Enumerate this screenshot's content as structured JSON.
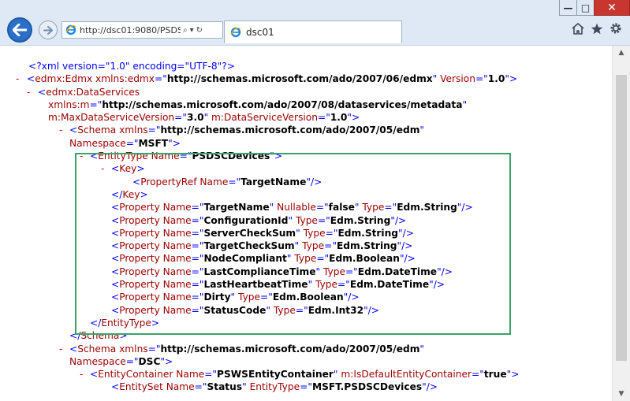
{
  "window": {
    "buttons": {
      "minimize": "—",
      "maximize": "□",
      "close": "✕"
    }
  },
  "toolbar": {
    "address": "http://dsc01:9080/PSDS",
    "search_glyph": "⌕",
    "dropdown_glyph": "▾",
    "refresh_glyph": "↻",
    "tab_title": "dsc01",
    "icons": [
      "home-icon",
      "favorites-star-icon",
      "settings-gear-icon"
    ]
  },
  "colors": {
    "markup": "#0000ff",
    "attribute": "#990000",
    "value": "#000000",
    "collapse_minus": "#e0001a",
    "highlight_border": "#3ba36a"
  },
  "xml": {
    "minus": "-",
    "lines": [
      {
        "m": "",
        "s": [
          [
            "b",
            "<?xml version=\"1.0\" encoding=\"UTF-8\"?>"
          ]
        ]
      },
      {
        "m": "-",
        "s": [
          [
            "b",
            "<"
          ],
          [
            "r",
            "edmx:Edmx "
          ],
          [
            "r",
            "xmlns:edmx"
          ],
          [
            "b",
            "=\""
          ],
          [
            "k",
            "http://schemas.microsoft.com/ado/2007/06/edmx"
          ],
          [
            "b",
            "\" "
          ],
          [
            "r",
            "Version"
          ],
          [
            "b",
            "=\""
          ],
          [
            "k",
            "1.0"
          ],
          [
            "b",
            "\">"
          ]
        ]
      },
      {
        "m": "-",
        "s": [
          [
            "b",
            "<"
          ],
          [
            "r",
            "edmx:DataServices"
          ]
        ]
      },
      {
        "m": "",
        "s": [
          [
            "r",
            "xmlns:m"
          ],
          [
            "b",
            "=\""
          ],
          [
            "k",
            "http://schemas.microsoft.com/ado/2007/08/dataservices/metadata"
          ],
          [
            "b",
            "\""
          ]
        ]
      },
      {
        "m": "",
        "s": [
          [
            "r",
            "m:MaxDataServiceVersion"
          ],
          [
            "b",
            "=\""
          ],
          [
            "k",
            "3.0"
          ],
          [
            "b",
            "\" "
          ],
          [
            "r",
            "m:DataServiceVersion"
          ],
          [
            "b",
            "=\""
          ],
          [
            "k",
            "1.0"
          ],
          [
            "b",
            "\">"
          ]
        ]
      },
      {
        "m": "-",
        "s": [
          [
            "b",
            "<"
          ],
          [
            "r",
            "Schema "
          ],
          [
            "r",
            "xmlns"
          ],
          [
            "b",
            "=\""
          ],
          [
            "k",
            "http://schemas.microsoft.com/ado/2007/05/edm"
          ],
          [
            "b",
            "\""
          ]
        ]
      },
      {
        "m": "",
        "s": [
          [
            "r",
            "Namespace"
          ],
          [
            "b",
            "=\""
          ],
          [
            "k",
            "MSFT"
          ],
          [
            "b",
            "\">"
          ]
        ]
      },
      {
        "m": "-",
        "s": [
          [
            "b",
            "<"
          ],
          [
            "r",
            "EntityType "
          ],
          [
            "r",
            "Name"
          ],
          [
            "b",
            "=\""
          ],
          [
            "k",
            "PSDSCDevices"
          ],
          [
            "b",
            "\">"
          ]
        ]
      },
      {
        "m": "-",
        "s": [
          [
            "b",
            "<"
          ],
          [
            "r",
            "Key"
          ],
          [
            "b",
            ">"
          ]
        ]
      },
      {
        "m": "",
        "s": [
          [
            "b",
            "<"
          ],
          [
            "r",
            "PropertyRef "
          ],
          [
            "r",
            "Name"
          ],
          [
            "b",
            "=\""
          ],
          [
            "k",
            "TargetName"
          ],
          [
            "b",
            "\"/>"
          ]
        ]
      },
      {
        "m": "",
        "s": [
          [
            "b",
            "</"
          ],
          [
            "r",
            "Key"
          ],
          [
            "b",
            ">"
          ]
        ]
      },
      {
        "m": "",
        "s": [
          [
            "b",
            "<"
          ],
          [
            "r",
            "Property "
          ],
          [
            "r",
            "Name"
          ],
          [
            "b",
            "=\""
          ],
          [
            "k",
            "TargetName"
          ],
          [
            "b",
            "\" "
          ],
          [
            "r",
            "Nullable"
          ],
          [
            "b",
            "=\""
          ],
          [
            "k",
            "false"
          ],
          [
            "b",
            "\" "
          ],
          [
            "r",
            "Type"
          ],
          [
            "b",
            "=\""
          ],
          [
            "k",
            "Edm.String"
          ],
          [
            "b",
            "\"/>"
          ]
        ]
      },
      {
        "m": "",
        "s": [
          [
            "b",
            "<"
          ],
          [
            "r",
            "Property "
          ],
          [
            "r",
            "Name"
          ],
          [
            "b",
            "=\""
          ],
          [
            "k",
            "ConfigurationId"
          ],
          [
            "b",
            "\" "
          ],
          [
            "r",
            "Type"
          ],
          [
            "b",
            "=\""
          ],
          [
            "k",
            "Edm.String"
          ],
          [
            "b",
            "\"/>"
          ]
        ]
      },
      {
        "m": "",
        "s": [
          [
            "b",
            "<"
          ],
          [
            "r",
            "Property "
          ],
          [
            "r",
            "Name"
          ],
          [
            "b",
            "=\""
          ],
          [
            "k",
            "ServerCheckSum"
          ],
          [
            "b",
            "\" "
          ],
          [
            "r",
            "Type"
          ],
          [
            "b",
            "=\""
          ],
          [
            "k",
            "Edm.String"
          ],
          [
            "b",
            "\"/>"
          ]
        ]
      },
      {
        "m": "",
        "s": [
          [
            "b",
            "<"
          ],
          [
            "r",
            "Property "
          ],
          [
            "r",
            "Name"
          ],
          [
            "b",
            "=\""
          ],
          [
            "k",
            "TargetCheckSum"
          ],
          [
            "b",
            "\" "
          ],
          [
            "r",
            "Type"
          ],
          [
            "b",
            "=\""
          ],
          [
            "k",
            "Edm.String"
          ],
          [
            "b",
            "\"/>"
          ]
        ]
      },
      {
        "m": "",
        "s": [
          [
            "b",
            "<"
          ],
          [
            "r",
            "Property "
          ],
          [
            "r",
            "Name"
          ],
          [
            "b",
            "=\""
          ],
          [
            "k",
            "NodeCompliant"
          ],
          [
            "b",
            "\" "
          ],
          [
            "r",
            "Type"
          ],
          [
            "b",
            "=\""
          ],
          [
            "k",
            "Edm.Boolean"
          ],
          [
            "b",
            "\"/>"
          ]
        ]
      },
      {
        "m": "",
        "s": [
          [
            "b",
            "<"
          ],
          [
            "r",
            "Property "
          ],
          [
            "r",
            "Name"
          ],
          [
            "b",
            "=\""
          ],
          [
            "k",
            "LastComplianceTime"
          ],
          [
            "b",
            "\" "
          ],
          [
            "r",
            "Type"
          ],
          [
            "b",
            "=\""
          ],
          [
            "k",
            "Edm.DateTime"
          ],
          [
            "b",
            "\"/>"
          ]
        ]
      },
      {
        "m": "",
        "s": [
          [
            "b",
            "<"
          ],
          [
            "r",
            "Property "
          ],
          [
            "r",
            "Name"
          ],
          [
            "b",
            "=\""
          ],
          [
            "k",
            "LastHeartbeatTime"
          ],
          [
            "b",
            "\" "
          ],
          [
            "r",
            "Type"
          ],
          [
            "b",
            "=\""
          ],
          [
            "k",
            "Edm.DateTime"
          ],
          [
            "b",
            "\"/>"
          ]
        ]
      },
      {
        "m": "",
        "s": [
          [
            "b",
            "<"
          ],
          [
            "r",
            "Property "
          ],
          [
            "r",
            "Name"
          ],
          [
            "b",
            "=\""
          ],
          [
            "k",
            "Dirty"
          ],
          [
            "b",
            "\" "
          ],
          [
            "r",
            "Type"
          ],
          [
            "b",
            "=\""
          ],
          [
            "k",
            "Edm.Boolean"
          ],
          [
            "b",
            "\"/>"
          ]
        ]
      },
      {
        "m": "",
        "s": [
          [
            "b",
            "<"
          ],
          [
            "r",
            "Property "
          ],
          [
            "r",
            "Name"
          ],
          [
            "b",
            "=\""
          ],
          [
            "k",
            "StatusCode"
          ],
          [
            "b",
            "\" "
          ],
          [
            "r",
            "Type"
          ],
          [
            "b",
            "=\""
          ],
          [
            "k",
            "Edm.Int32"
          ],
          [
            "b",
            "\"/>"
          ]
        ]
      },
      {
        "m": "",
        "s": [
          [
            "b",
            "</"
          ],
          [
            "r",
            "EntityType"
          ],
          [
            "b",
            ">"
          ]
        ]
      },
      {
        "m": "",
        "s": [
          [
            "b",
            "</"
          ],
          [
            "r",
            "Schema"
          ],
          [
            "b",
            ">"
          ]
        ]
      },
      {
        "m": "-",
        "s": [
          [
            "b",
            "<"
          ],
          [
            "r",
            "Schema "
          ],
          [
            "r",
            "xmlns"
          ],
          [
            "b",
            "=\""
          ],
          [
            "k",
            "http://schemas.microsoft.com/ado/2007/05/edm"
          ],
          [
            "b",
            "\""
          ]
        ]
      },
      {
        "m": "",
        "s": [
          [
            "r",
            "Namespace"
          ],
          [
            "b",
            "=\""
          ],
          [
            "k",
            "DSC"
          ],
          [
            "b",
            "\">"
          ]
        ]
      },
      {
        "m": "-",
        "s": [
          [
            "b",
            "<"
          ],
          [
            "r",
            "EntityContainer "
          ],
          [
            "r",
            "Name"
          ],
          [
            "b",
            "=\""
          ],
          [
            "k",
            "PSWSEntityContainer"
          ],
          [
            "b",
            "\" "
          ],
          [
            "r",
            "m:IsDefaultEntityContainer"
          ],
          [
            "b",
            "=\""
          ],
          [
            "k",
            "true"
          ],
          [
            "b",
            "\">"
          ]
        ]
      },
      {
        "m": "",
        "s": [
          [
            "b",
            "<"
          ],
          [
            "r",
            "EntitySet "
          ],
          [
            "r",
            "Name"
          ],
          [
            "b",
            "=\""
          ],
          [
            "k",
            "Status"
          ],
          [
            "b",
            "\" "
          ],
          [
            "r",
            "EntityType"
          ],
          [
            "b",
            "=\""
          ],
          [
            "k",
            "MSFT.PSDSCDevices"
          ],
          [
            "b",
            "\"/>"
          ]
        ]
      }
    ]
  }
}
